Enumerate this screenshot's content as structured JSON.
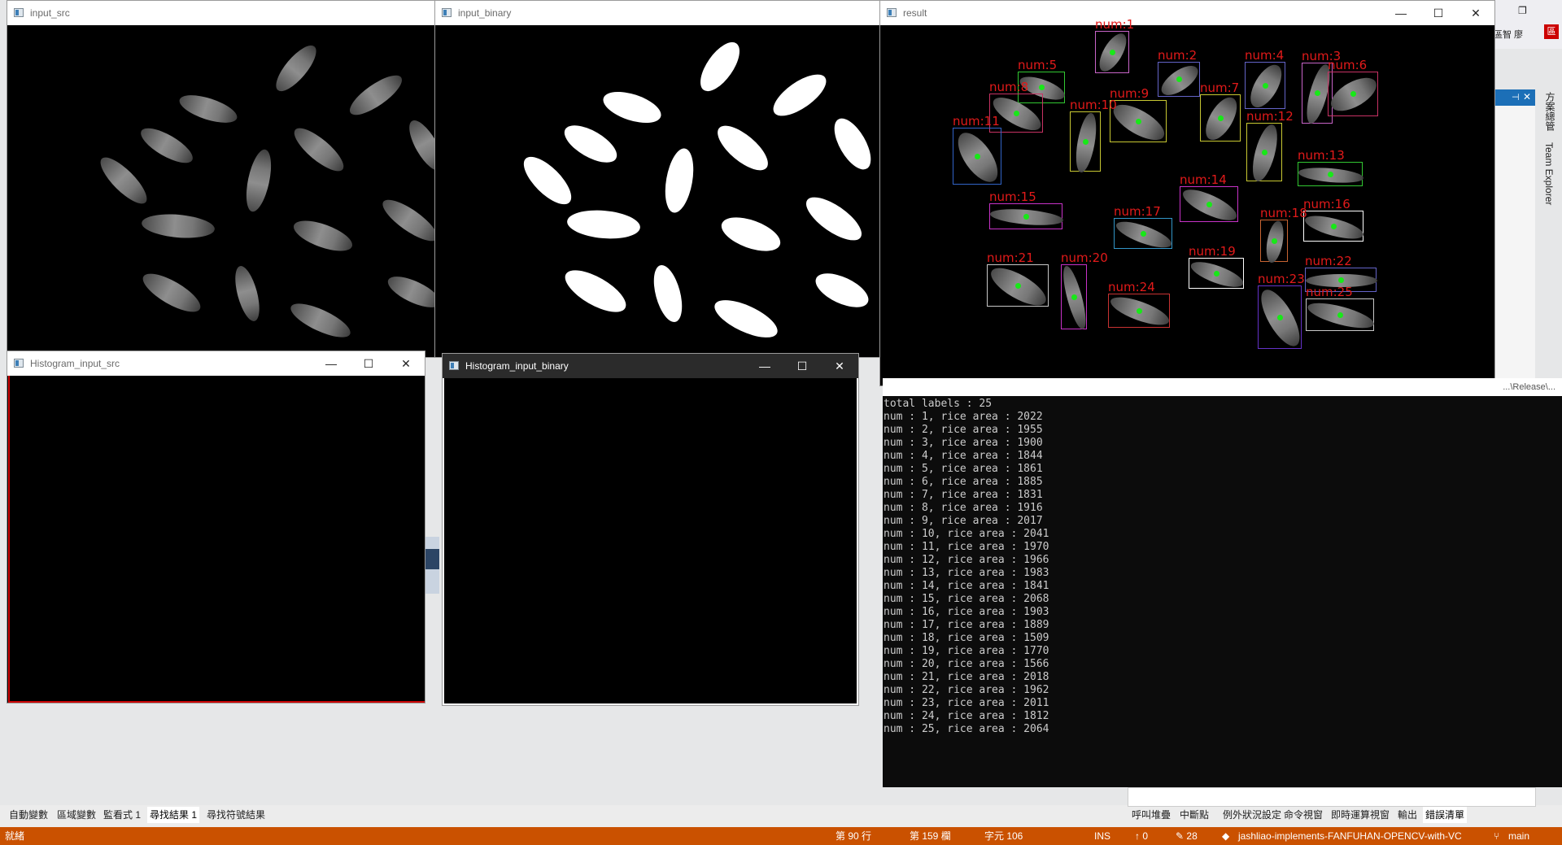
{
  "windows": {
    "input_src": {
      "title": "input_src"
    },
    "input_binary": {
      "title": "input_binary"
    },
    "result": {
      "title": "result"
    },
    "hist_src": {
      "title": "Histogram_input_src"
    },
    "hist_binary": {
      "title": "Histogram_input_binary"
    }
  },
  "window_buttons": {
    "minimize": "—",
    "maximize": "☐",
    "close": "✕"
  },
  "result_labels": [
    "num:1",
    "num:2",
    "num:3",
    "num:4",
    "num:5",
    "num:6",
    "num:7",
    "num:8",
    "num:9",
    "num:10",
    "num:11",
    "num:12",
    "num:13",
    "num:14",
    "num:15",
    "num:16",
    "num:17",
    "num:18",
    "num:19",
    "num:20",
    "num:21",
    "num:22",
    "num:23",
    "num:24",
    "num:25"
  ],
  "console": {
    "path_text": "...\\Release\\...",
    "lines": [
      "total labels : 25",
      "num : 1, rice area : 2022",
      "num : 2, rice area : 1955",
      "num : 3, rice area : 1900",
      "num : 4, rice area : 1844",
      "num : 5, rice area : 1861",
      "num : 6, rice area : 1885",
      "num : 7, rice area : 1831",
      "num : 8, rice area : 1916",
      "num : 9, rice area : 2017",
      "num : 10, rice area : 2041",
      "num : 11, rice area : 1970",
      "num : 12, rice area : 1966",
      "num : 13, rice area : 1983",
      "num : 14, rice area : 1841",
      "num : 15, rice area : 2068",
      "num : 16, rice area : 1903",
      "num : 17, rice area : 1889",
      "num : 18, rice area : 1509",
      "num : 19, rice area : 1770",
      "num : 20, rice area : 1566",
      "num : 21, rice area : 2018",
      "num : 22, rice area : 1962",
      "num : 23, rice area : 2011",
      "num : 24, rice area : 1812",
      "num : 25, rice area : 2064"
    ]
  },
  "bottom_tabs_left": [
    "自動變數",
    "區域變數",
    "監看式 1",
    "尋找結果 1",
    "尋找符號結果"
  ],
  "bottom_tabs_right": [
    "呼叫堆疊",
    "中斷點",
    "例外狀況設定",
    "命令視窗",
    "即時運算視窗",
    "輸出",
    "錯誤清單"
  ],
  "vs_right_panel": {
    "tab1": "方案總管",
    "tab2": "Team Explorer",
    "user": "區智 廖"
  },
  "status": {
    "ready": "就緒",
    "line": "第 90 行",
    "col": "第 159 欄",
    "char": "字元 106",
    "ins": "INS",
    "up": "↑ 0",
    "edits": "✎ 28",
    "repo": "jashliao-implements-FANFUHAN-OPENCV-with-VC",
    "branch": "main"
  },
  "colors": {
    "status_orange": "#ca5100",
    "label_red": "#e21a1a",
    "centroid_green": "#18e818"
  }
}
